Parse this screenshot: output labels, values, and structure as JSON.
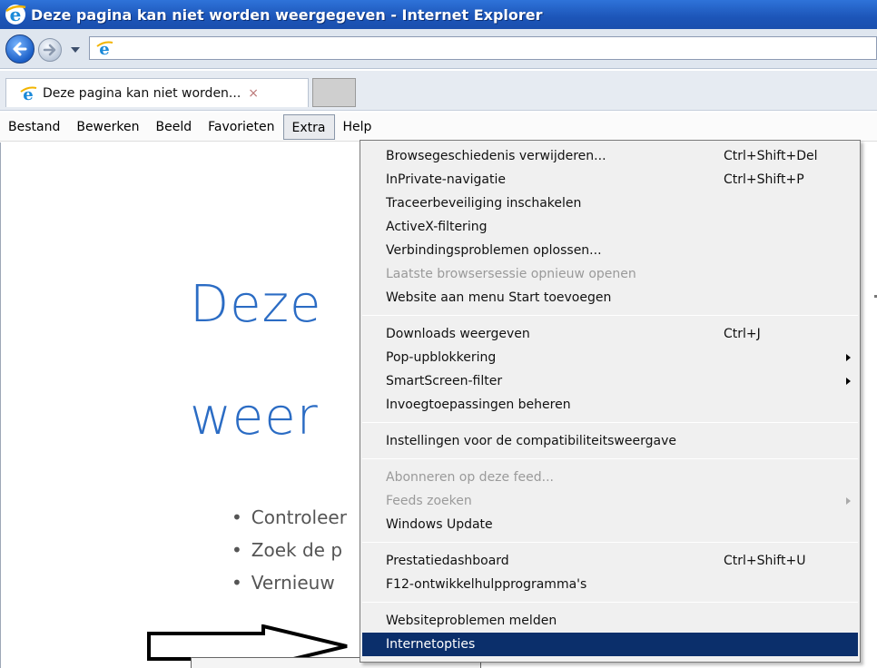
{
  "window": {
    "title": "Deze pagina kan niet worden weergegeven - Internet Explorer"
  },
  "tab": {
    "title": "Deze pagina kan niet worden...",
    "close": "×"
  },
  "menubar": {
    "items": [
      "Bestand",
      "Bewerken",
      "Beeld",
      "Favorieten",
      "Extra",
      "Help"
    ],
    "active": "Extra"
  },
  "page": {
    "headline_1": "Deze",
    "headline_2": "weer",
    "bullets": [
      "Controleer",
      "Zoek de p",
      "Vernieuw"
    ]
  },
  "extra_menu": {
    "group1": [
      {
        "label": "Browsegeschiedenis verwijderen...",
        "shortcut": "Ctrl+Shift+Del"
      },
      {
        "label": "InPrivate-navigatie",
        "shortcut": "Ctrl+Shift+P"
      },
      {
        "label": "Traceerbeveiliging inschakelen",
        "shortcut": ""
      },
      {
        "label": "ActiveX-filtering",
        "shortcut": ""
      },
      {
        "label": "Verbindingsproblemen oplossen...",
        "shortcut": ""
      },
      {
        "label": "Laatste browsersessie opnieuw openen",
        "shortcut": "",
        "disabled": true
      },
      {
        "label": "Website aan menu Start toevoegen",
        "shortcut": ""
      }
    ],
    "group2": [
      {
        "label": "Downloads weergeven",
        "shortcut": "Ctrl+J"
      },
      {
        "label": "Pop-upblokkering",
        "submenu": true
      },
      {
        "label": "SmartScreen-filter",
        "submenu": true
      },
      {
        "label": "Invoegtoepassingen beheren"
      }
    ],
    "group3": [
      {
        "label": "Instellingen voor de compatibiliteitsweergave"
      }
    ],
    "group4": [
      {
        "label": "Abonneren op deze feed...",
        "disabled": true
      },
      {
        "label": "Feeds zoeken",
        "disabled": true,
        "submenu": true
      },
      {
        "label": "Windows Update"
      }
    ],
    "group5": [
      {
        "label": "Prestatiedashboard",
        "shortcut": "Ctrl+Shift+U"
      },
      {
        "label": "F12-ontwikkelhulpprogramma's"
      }
    ],
    "group6": [
      {
        "label": "Websiteproblemen melden"
      },
      {
        "label": "Internetopties",
        "selected": true
      }
    ]
  },
  "colors": {
    "title_bar": "#1c55b8",
    "headline": "#2b6cc4",
    "menu_selected": "#0b2f6b",
    "menu_background": "#f0f0f0"
  },
  "icons": [
    "ie-logo-icon",
    "back-arrow-icon",
    "forward-arrow-icon",
    "dropdown-arrow-icon",
    "close-icon",
    "submenu-arrow-icon",
    "pointer-arrow-icon"
  ]
}
